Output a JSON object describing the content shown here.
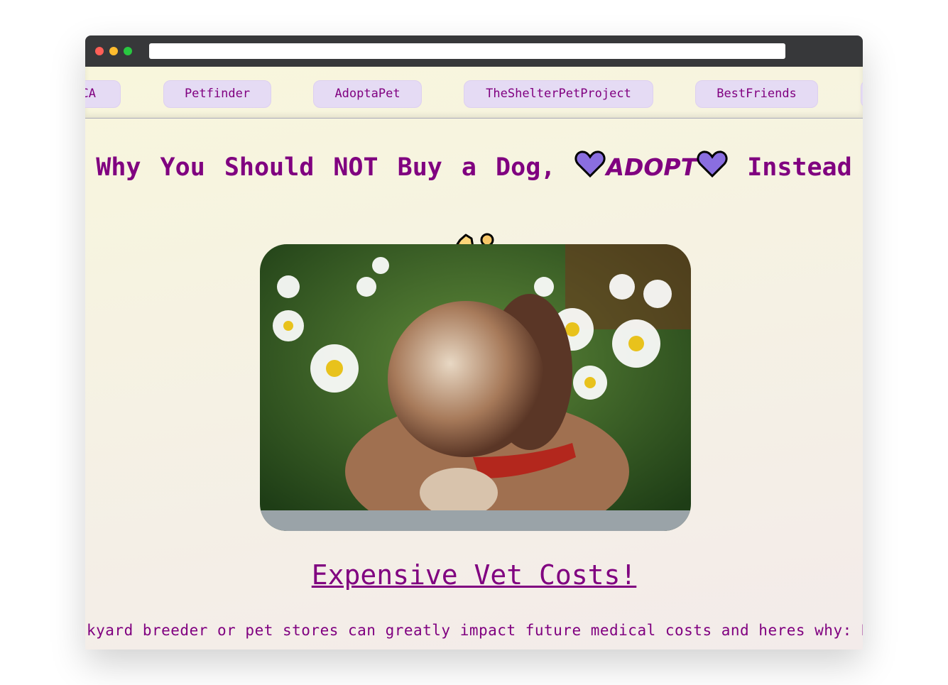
{
  "browser": {
    "dots": [
      "#ff5f57",
      "#febc2e",
      "#28c840"
    ]
  },
  "nav": {
    "items": [
      {
        "label": "CA"
      },
      {
        "label": "Petfinder"
      },
      {
        "label": "AdoptaPet"
      },
      {
        "label": "TheShelterPetProject"
      },
      {
        "label": "BestFriends"
      },
      {
        "label": ""
      }
    ]
  },
  "hero": {
    "title_before": "Why You Should NOT Buy a Dog,",
    "title_emphasis": "ADOPT",
    "title_after": "Instead",
    "emoji": "dog-icon",
    "image": "puppy-in-daisies-photo"
  },
  "section": {
    "heading": "Expensive Vet Costs!",
    "text": "kyard breeder or pet stores can greatly impact future medical costs and heres why: Back"
  },
  "colors": {
    "accent": "#800080",
    "button_bg": "#e5dbf4",
    "heart": "#8a6ee0"
  }
}
